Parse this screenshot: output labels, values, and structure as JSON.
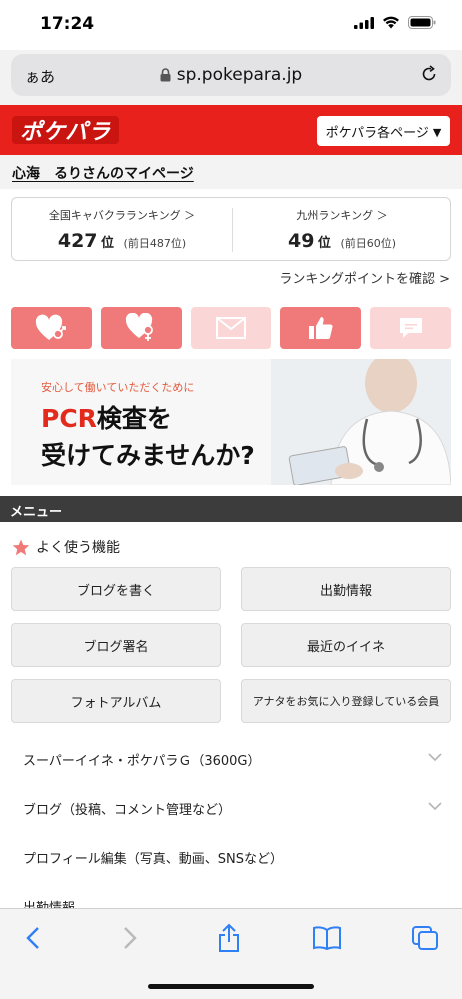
{
  "status_bar": {
    "time": "17:24"
  },
  "url_bar": {
    "aa": "ぁあ",
    "url": "sp.pokepara.jp"
  },
  "header": {
    "logo": "ポケパラ",
    "pages_button": "ポケパラ各ページ"
  },
  "mypage": {
    "title": "心海　るりさんのマイページ"
  },
  "ranking": {
    "national": {
      "label": "全国キャバクラランキング ＞",
      "rank": "427",
      "unit": "位",
      "previous": "(前日487位)"
    },
    "regional": {
      "label": "九州ランキング ＞",
      "rank": "49",
      "unit": "位",
      "previous": "(前日60位)"
    },
    "points_link": "ランキングポイントを確認 >"
  },
  "icon_buttons": [
    {
      "icon": "heart-male-icon",
      "state": "on"
    },
    {
      "icon": "heart-female-icon",
      "state": "on"
    },
    {
      "icon": "mail-icon",
      "state": "off"
    },
    {
      "icon": "thumbs-up-icon",
      "state": "on"
    },
    {
      "icon": "chat-icon",
      "state": "off"
    }
  ],
  "banner": {
    "subtitle": "安心して働いていただくために",
    "line1_accent": "PCR",
    "line1_rest": "検査を",
    "line2": "受けてみませんか?"
  },
  "menu": {
    "header": "メニュー",
    "favorites_title": "よく使う機能",
    "favorites": [
      "ブログを書く",
      "出勤情報",
      "ブログ署名",
      "最近のイイネ",
      "フォトアルバム",
      "アナタをお気に入り登録している会員"
    ],
    "sections": [
      {
        "label": "スーパーイイネ・ポケパラＧ（3600G）",
        "expandable": true
      },
      {
        "label": "ブログ（投稿、コメント管理など）",
        "expandable": true
      },
      {
        "label": "プロフィール編集（写真、動画、SNSなど）",
        "expandable": false
      },
      {
        "label": "出勤情報",
        "expandable": false
      }
    ]
  },
  "colors": {
    "brand_red": "#e8211d",
    "icon_on": "#f07a79",
    "icon_off": "#fbd6d6",
    "ios_blue": "#2f7ff5"
  }
}
